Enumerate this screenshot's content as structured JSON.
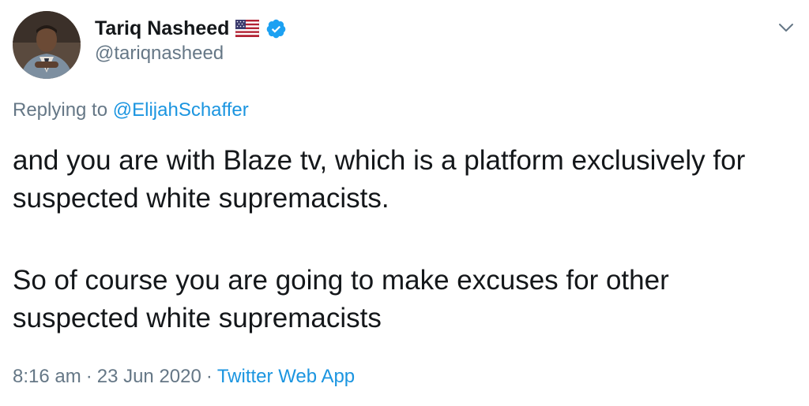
{
  "author": {
    "display_name": "Tariq Nasheed",
    "handle": "@tariqnasheed",
    "avatar_icon": "profile-photo",
    "flag_icon": "us-flag-icon",
    "verified_icon": "verified-badge-icon"
  },
  "reply": {
    "prefix": "Replying to",
    "mention": "@ElijahSchaffer"
  },
  "tweet": {
    "paragraph_1": "and you are with Blaze tv, which is a platform exclusively for suspected white supremacists.",
    "paragraph_2": "So of course you are going to make excuses for other suspected white supremacists"
  },
  "meta": {
    "time": "8:16 am",
    "separator": "·",
    "date": "23 Jun 2020",
    "separator_2": "·",
    "source": "Twitter Web App"
  },
  "colors": {
    "text": "#14171a",
    "secondary": "#657786",
    "link": "#1b95e0",
    "verified": "#1da1f2"
  }
}
